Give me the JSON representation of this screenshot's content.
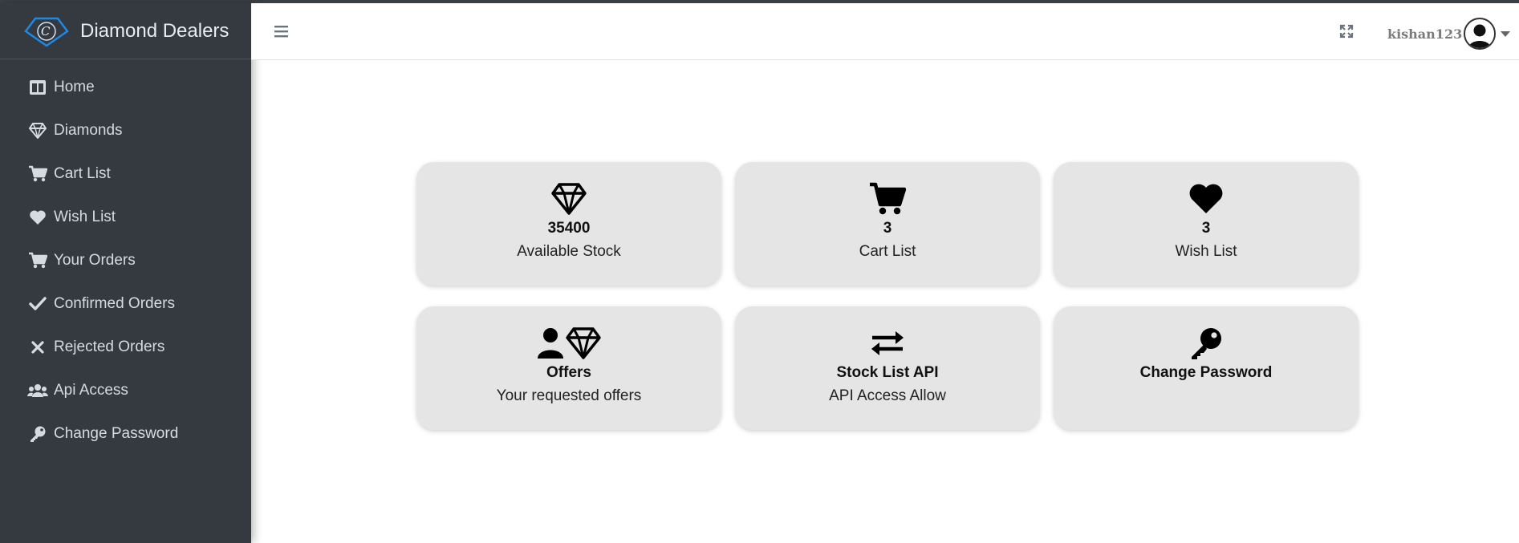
{
  "app": {
    "title": "Diamond Dealers"
  },
  "sidebar": {
    "items": [
      {
        "label": "Home",
        "icon": "home-icon"
      },
      {
        "label": "Diamonds",
        "icon": "diamond-icon"
      },
      {
        "label": "Cart List",
        "icon": "cart-icon"
      },
      {
        "label": "Wish List",
        "icon": "heart-icon"
      },
      {
        "label": "Your Orders",
        "icon": "cart-icon"
      },
      {
        "label": "Confirmed Orders",
        "icon": "check-icon"
      },
      {
        "label": "Rejected Orders",
        "icon": "x-icon"
      },
      {
        "label": "Api Access",
        "icon": "users-icon"
      },
      {
        "label": "Change Password",
        "icon": "key-icon"
      }
    ]
  },
  "header": {
    "username": "kishan123"
  },
  "cards": [
    {
      "value": "35400",
      "label": "Available Stock",
      "icon": "diamond-icon"
    },
    {
      "value": "3",
      "label": "Cart List",
      "icon": "cart-icon"
    },
    {
      "value": "3",
      "label": "Wish List",
      "icon": "heart-icon"
    },
    {
      "value": "Offers",
      "label": "Your requested offers",
      "icon": "user-diamond-icon"
    },
    {
      "value": "Stock List API",
      "label": "API Access Allow",
      "icon": "exchange-icon"
    },
    {
      "value": "Change Password",
      "label": "",
      "icon": "key-icon"
    }
  ],
  "colors": {
    "sidebar_bg": "#343a40",
    "card_bg": "#e5e5e5",
    "logo_blue": "#1e88e5"
  }
}
